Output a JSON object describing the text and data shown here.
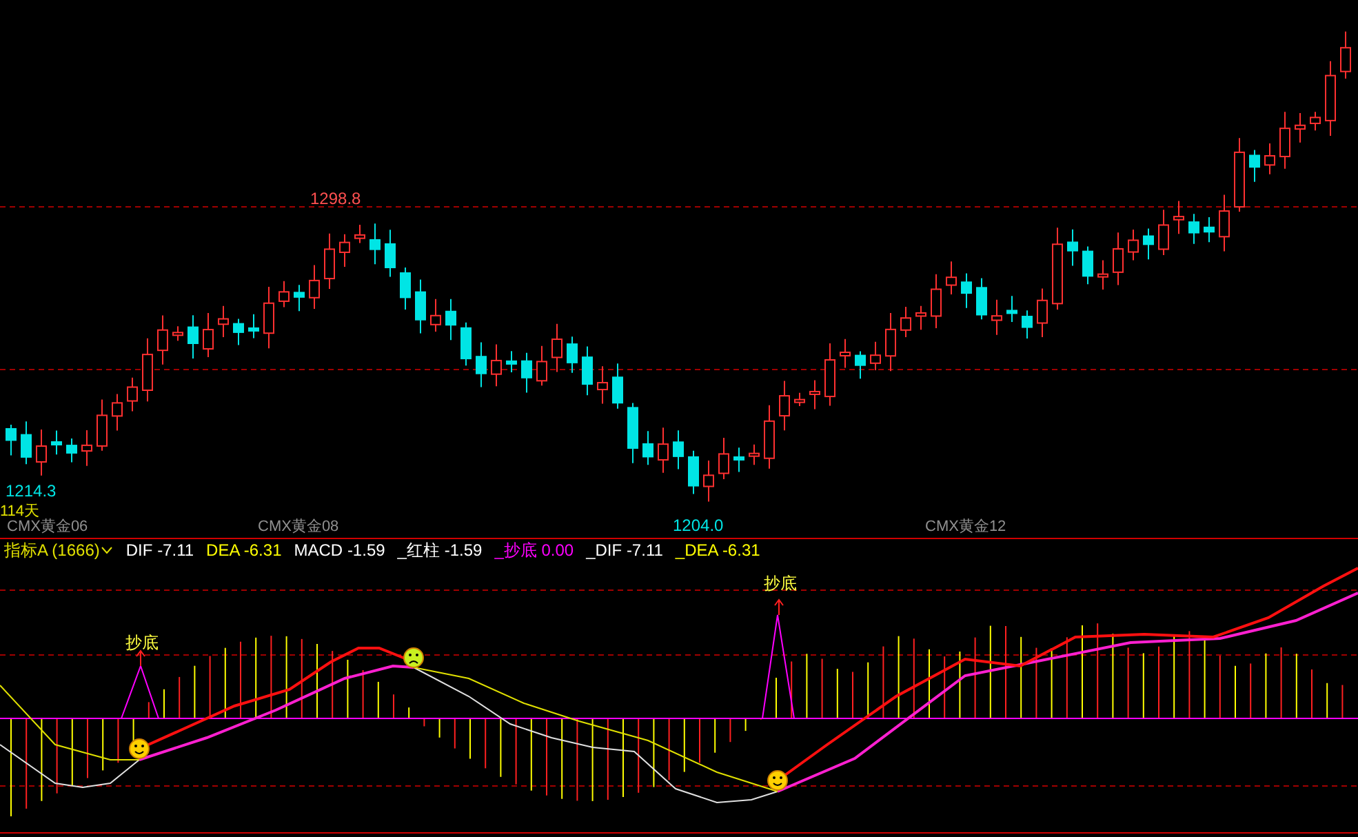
{
  "main_chart": {
    "price_labels": [
      {
        "text": "1298.8",
        "color": "#ff5050"
      },
      {
        "text": "1214.3",
        "color": "#00e5e5"
      },
      {
        "text": "1204.0",
        "color": "#00e5e5"
      }
    ],
    "day_count": "114天",
    "contract_labels": [
      "CMX黄金06",
      "CMX黄金08",
      "CMX黄金12"
    ]
  },
  "indicator_bar": {
    "selector": "指标A (1666)",
    "readings": [
      {
        "label": "DIF",
        "value": "-7.11",
        "color": "#ffffff"
      },
      {
        "label": "DEA",
        "value": "-6.31",
        "color": "#ffff00"
      },
      {
        "label": "MACD",
        "value": "-1.59",
        "color": "#ffffff"
      },
      {
        "label": "_红柱",
        "value": "-1.59",
        "color": "#ffffff"
      },
      {
        "label": "_抄底",
        "value": "0.00",
        "color": "#ff00ff"
      },
      {
        "label": "_DIF",
        "value": "-7.11",
        "color": "#ffffff"
      },
      {
        "label": "_DEA",
        "value": "-6.31",
        "color": "#ffff00"
      }
    ]
  },
  "macd_panel": {
    "signals": [
      "抄底",
      "抄底"
    ]
  }
}
